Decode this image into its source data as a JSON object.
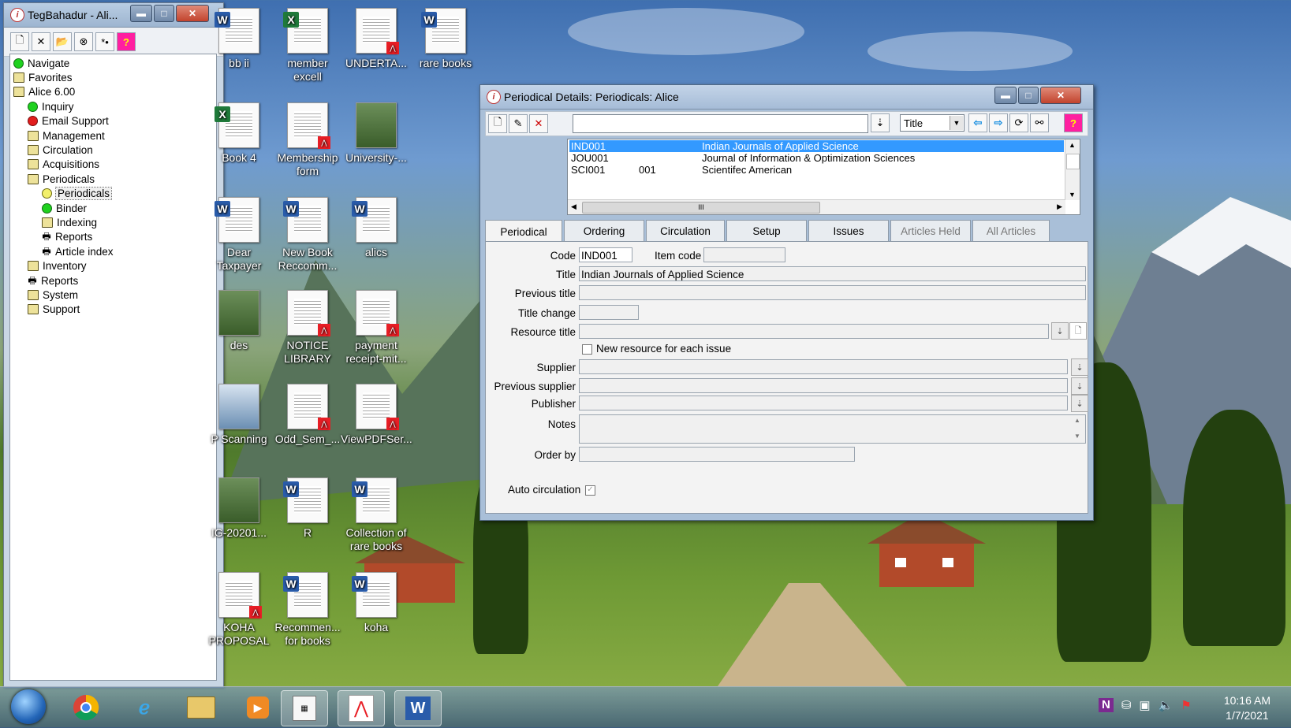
{
  "nav_window": {
    "title": "TegBahadur - Ali...",
    "tree": [
      {
        "label": "Navigate",
        "icon": "green-dot-icon",
        "level": 0
      },
      {
        "label": "Favorites",
        "icon": "folder-icon",
        "level": 0
      },
      {
        "label": "Alice 6.00",
        "icon": "folder-icon",
        "level": 0
      },
      {
        "label": "Inquiry",
        "icon": "green-dot-icon",
        "level": 1
      },
      {
        "label": "Email Support",
        "icon": "red-dot-icon",
        "level": 1
      },
      {
        "label": "Management",
        "icon": "folder-icon",
        "level": 1
      },
      {
        "label": "Circulation",
        "icon": "folder-icon",
        "level": 1
      },
      {
        "label": "Acquisitions",
        "icon": "folder-icon",
        "level": 1
      },
      {
        "label": "Periodicals",
        "icon": "folder-icon",
        "level": 1
      },
      {
        "label": "Periodicals",
        "icon": "yellow-dot-icon",
        "level": 2,
        "selected": true
      },
      {
        "label": "Binder",
        "icon": "green-dot-icon",
        "level": 2
      },
      {
        "label": "Indexing",
        "icon": "folder-icon",
        "level": 2
      },
      {
        "label": "Reports",
        "icon": "printer-icon",
        "level": 2
      },
      {
        "label": "Article index",
        "icon": "printer-icon",
        "level": 2
      },
      {
        "label": "Inventory",
        "icon": "folder-icon",
        "level": 1
      },
      {
        "label": "Reports",
        "icon": "printer-icon",
        "level": 1
      },
      {
        "label": "System",
        "icon": "folder-icon",
        "level": 1
      },
      {
        "label": "Support",
        "icon": "folder-icon",
        "level": 1
      }
    ]
  },
  "desktop_icons": [
    {
      "label": "bb ii",
      "type": "word"
    },
    {
      "label": "member excell",
      "type": "excel"
    },
    {
      "label": "UNDERTA...",
      "type": "pdf"
    },
    {
      "label": "rare books",
      "type": "word"
    },
    {
      "label": "Book 4",
      "type": "excel"
    },
    {
      "label": "Membership form",
      "type": "pdf"
    },
    {
      "label": "University-...",
      "type": "image"
    },
    {
      "label": "Dear Taxpayer",
      "type": "word"
    },
    {
      "label": "New Book Reccomm...",
      "type": "word"
    },
    {
      "label": "alics",
      "type": "word"
    },
    {
      "label": "des",
      "type": "image"
    },
    {
      "label": "NOTICE LIBRARY",
      "type": "pdf"
    },
    {
      "label": "payment receipt-mit...",
      "type": "pdf"
    },
    {
      "label": "P Scanning",
      "type": "scanner"
    },
    {
      "label": "Odd_Sem_...",
      "type": "pdf"
    },
    {
      "label": "ViewPDFSer...",
      "type": "pdf"
    },
    {
      "label": "IG-20201...",
      "type": "image"
    },
    {
      "label": "R",
      "type": "word"
    },
    {
      "label": "Collection of rare books",
      "type": "word"
    },
    {
      "label": "KOHA PROPOSAL",
      "type": "pdf"
    },
    {
      "label": "Recommen... for books",
      "type": "word"
    },
    {
      "label": "koha",
      "type": "word"
    }
  ],
  "periodical_window": {
    "title": "Periodical Details: Periodicals: Alice",
    "search_value": "",
    "search_field": "Title",
    "list": [
      {
        "code": "IND001",
        "item": "",
        "title": "Indian Journals of Applied Science",
        "selected": true
      },
      {
        "code": "JOU001",
        "item": "",
        "title": "Journal of Information & Optimization Sciences",
        "selected": false
      },
      {
        "code": "SCI001",
        "item": "001",
        "title": "Scientifec American",
        "selected": false
      }
    ],
    "hscroll_label": "III",
    "tabs": [
      {
        "label": "Periodical",
        "active": true,
        "enabled": true
      },
      {
        "label": "Ordering",
        "active": false,
        "enabled": true
      },
      {
        "label": "Circulation",
        "active": false,
        "enabled": true
      },
      {
        "label": "Setup",
        "active": false,
        "enabled": true
      },
      {
        "label": "Issues",
        "active": false,
        "enabled": true
      },
      {
        "label": "Articles Held",
        "active": false,
        "enabled": false
      },
      {
        "label": "All Articles",
        "active": false,
        "enabled": false
      }
    ],
    "form": {
      "code_label": "Code",
      "code_value": "IND001",
      "item_code_label": "Item code",
      "item_code_value": "",
      "title_label": "Title",
      "title_value": "Indian Journals of Applied Science",
      "previous_title_label": "Previous title",
      "previous_title_value": "",
      "title_change_label": "Title change",
      "title_change_value": "",
      "resource_title_label": "Resource title",
      "resource_title_value": "",
      "new_resource_label": "New resource for each issue",
      "new_resource_checked": false,
      "supplier_label": "Supplier",
      "supplier_value": "",
      "previous_supplier_label": "Previous supplier",
      "previous_supplier_value": "",
      "publisher_label": "Publisher",
      "publisher_value": "",
      "notes_label": "Notes",
      "notes_value": "",
      "order_by_label": "Order by",
      "order_by_value": "",
      "auto_circulation_label": "Auto circulation",
      "auto_circulation_checked": true
    }
  },
  "taskbar": {
    "time": "10:16 AM",
    "date": "1/7/2021"
  },
  "colors": {
    "selection": "#3399ff",
    "help_button": "#ff1fa0",
    "window_frame": "#a9bfd8"
  }
}
